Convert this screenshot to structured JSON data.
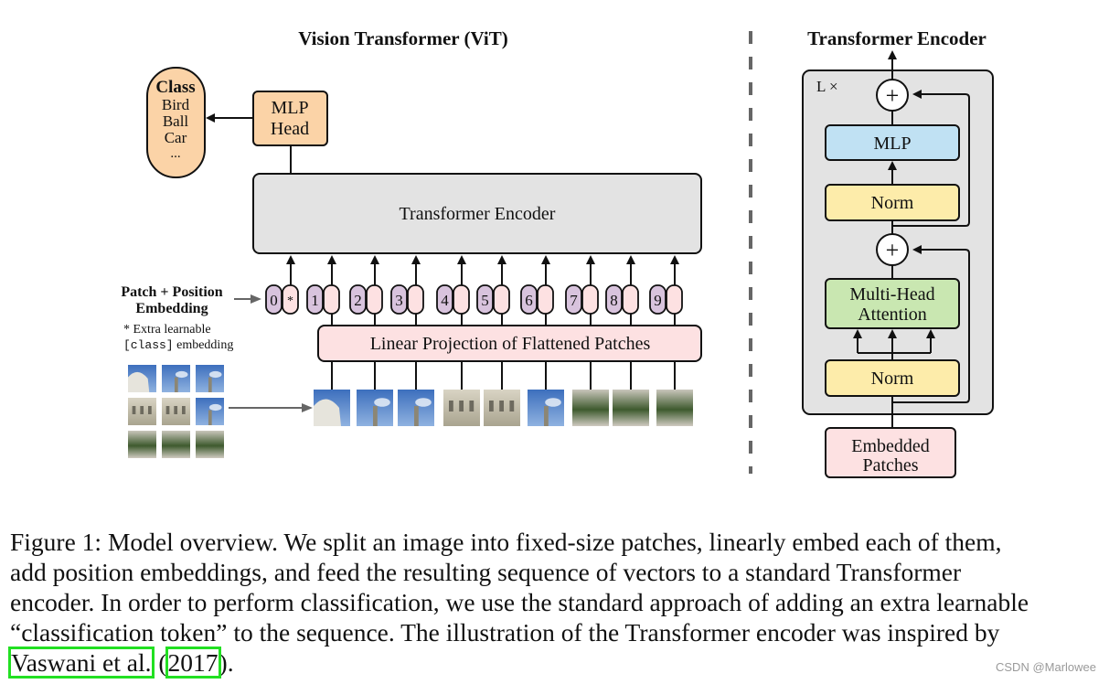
{
  "vit": {
    "title": "Vision Transformer (ViT)",
    "class_box": {
      "heading": "Class",
      "items": [
        "Bird",
        "Ball",
        "Car",
        "..."
      ]
    },
    "mlp_head": [
      "MLP",
      "Head"
    ],
    "encoder_label": "Transformer Encoder",
    "embedding_label": [
      "Patch + Position",
      "Embedding"
    ],
    "extra_note": {
      "line1": "* Extra learnable",
      "code": "[class]",
      "line2_rest": " embedding"
    },
    "tokens": [
      {
        "pos": "0",
        "content": "*"
      },
      {
        "pos": "1",
        "content": ""
      },
      {
        "pos": "2",
        "content": ""
      },
      {
        "pos": "3",
        "content": ""
      },
      {
        "pos": "4",
        "content": ""
      },
      {
        "pos": "5",
        "content": ""
      },
      {
        "pos": "6",
        "content": ""
      },
      {
        "pos": "7",
        "content": ""
      },
      {
        "pos": "8",
        "content": ""
      },
      {
        "pos": "9",
        "content": ""
      }
    ],
    "projection_label": "Linear Projection of Flattened Patches",
    "patch_count": 9
  },
  "encoder_detail": {
    "title": "Transformer Encoder",
    "repeat_label": "L ×",
    "blocks": {
      "mlp": "MLP",
      "norm_top": "Norm",
      "attention": [
        "Multi-Head",
        "Attention"
      ],
      "norm_bottom": "Norm",
      "input": [
        "Embedded",
        "Patches"
      ]
    },
    "add_symbol": "+"
  },
  "colors": {
    "class_fill": "#fbd3a7",
    "mlp_head_fill": "#fbd3a7",
    "encoder_fill": "#e3e3e3",
    "token_pos_fill": "#d8c3dd",
    "token_content_fill": "#fde1e2",
    "projection_fill": "#fde1e2",
    "mlp_fill": "#c0e1f3",
    "norm_fill": "#fdecaa",
    "attention_fill": "#c9e7b1",
    "embedded_fill": "#fde1e2",
    "citation_box": "#22e022"
  },
  "caption": {
    "lines": [
      "Figure 1: Model overview. We split an image into fixed-size patches, linearly embed each of them,",
      "add position embeddings, and feed the resulting sequence of vectors to a standard Transformer",
      "encoder. In order to perform classification, we use the standard approach of adding an extra learnable",
      "“classification token” to the sequence. The illustration of the Transformer encoder was inspired by"
    ],
    "cite_author": "Vaswani et al.",
    "cite_open": " (",
    "cite_year": "2017",
    "cite_close": ")."
  },
  "watermark": "CSDN @Marlowee"
}
